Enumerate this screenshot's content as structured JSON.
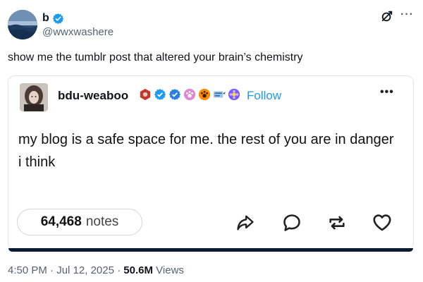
{
  "author": {
    "display_name": "b",
    "handle": "@wwxwashere",
    "verified_color": "#1d9bf0"
  },
  "tweet": {
    "text": "show me the tumblr post that altered your brain’s chemistry",
    "time": "4:50 PM",
    "date": "Jul 12, 2025",
    "views_count": "50.6M",
    "views_label": "Views",
    "separator": "·"
  },
  "icons": {
    "grok": "grok-icon",
    "more": "···"
  },
  "tumblr_post": {
    "username": "bdu-weaboo",
    "follow_label": "Follow",
    "more": "•••",
    "body": "my blog is a safe space for me. the rest of you are in danger i think",
    "notes_count": "64,468",
    "notes_label": "notes",
    "badges": [
      "hexagon-badge-icon",
      "blue-check-badge-icon",
      "blue-check-badge-icon",
      "pink-paw-badge-icon",
      "orange-paw-badge-icon",
      "bird-badge-icon",
      "purple-flower-badge-icon"
    ],
    "actions": [
      "share-icon",
      "reply-icon",
      "reblog-icon",
      "like-icon"
    ],
    "accent_color": "#1d9bf0"
  }
}
